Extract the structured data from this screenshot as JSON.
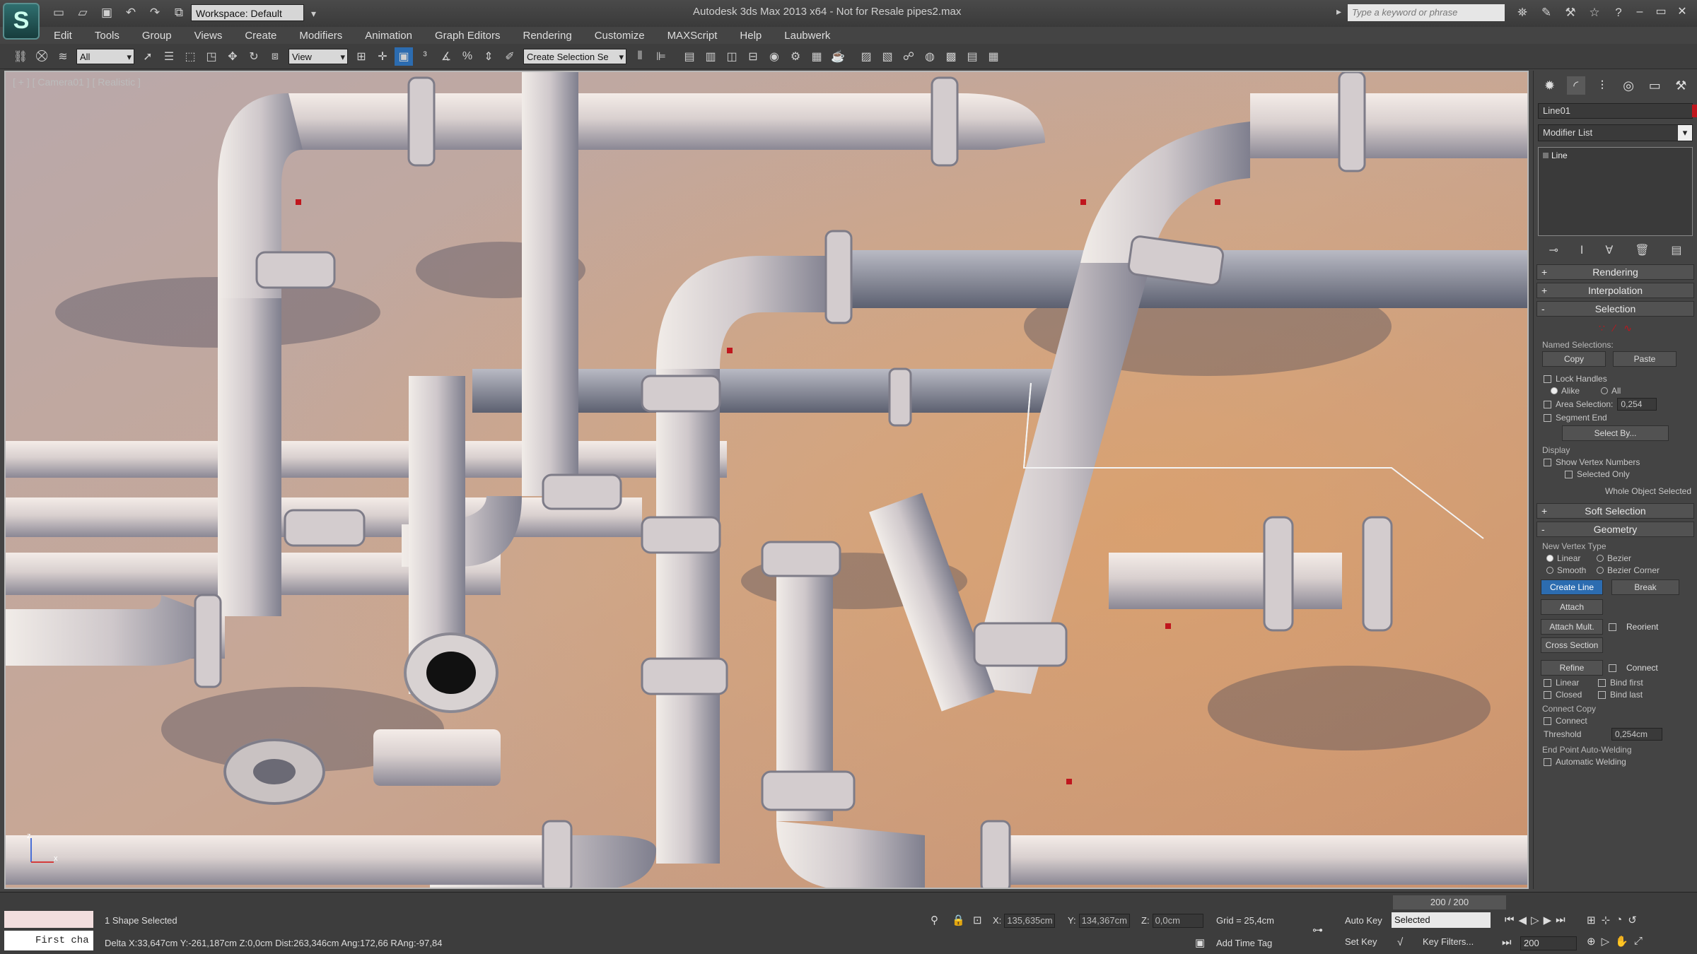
{
  "window": {
    "title": "Autodesk 3ds Max  2013 x64    - Not for Resale    pipes2.max",
    "workspace": "Workspace: Default",
    "search_placeholder": "Type a keyword or phrase"
  },
  "menu": [
    "Edit",
    "Tools",
    "Group",
    "Views",
    "Create",
    "Modifiers",
    "Animation",
    "Graph Editors",
    "Rendering",
    "Customize",
    "MAXScript",
    "Help",
    "Laubwerk"
  ],
  "toolbar": {
    "filter_select": "All",
    "view_select": "View",
    "selection_set": "Create Selection Se"
  },
  "viewport": {
    "label": "[ + ] [ Camera01 ] [ Realistic ]"
  },
  "command_panel": {
    "object_name": "Line01",
    "object_color": "#c0161d",
    "modifier_list": "Modifier List",
    "stack_item": "Line",
    "rollouts": {
      "rendering": "Rendering",
      "interpolation": "Interpolation",
      "selection": "Selection",
      "soft_selection": "Soft Selection",
      "geometry": "Geometry"
    },
    "selection": {
      "named_selections": "Named Selections:",
      "copy": "Copy",
      "paste": "Paste",
      "lock_handles": "Lock Handles",
      "alike": "Alike",
      "all": "All",
      "area_selection": "Area Selection:",
      "area_value": "0,254",
      "segment_end": "Segment End",
      "select_by": "Select By...",
      "display": "Display",
      "show_vertex_numbers": "Show Vertex Numbers",
      "selected_only": "Selected Only",
      "whole_object_selected": "Whole Object Selected"
    },
    "geometry": {
      "new_vertex_type": "New Vertex Type",
      "linear": "Linear",
      "bezier": "Bezier",
      "smooth": "Smooth",
      "bezier_corner": "Bezier Corner",
      "create_line": "Create Line",
      "break": "Break",
      "attach": "Attach",
      "reorient": "Reorient",
      "attach_mult": "Attach Mult.",
      "cross_section": "Cross Section",
      "refine": "Refine",
      "connect": "Connect",
      "linear2": "Linear",
      "bind_first": "Bind first",
      "closed": "Closed",
      "bind_last": "Bind last",
      "connect_copy": "Connect Copy",
      "connect2": "Connect",
      "threshold": "Threshold",
      "threshold_value": "0,254cm",
      "end_point_auto_welding": "End Point Auto-Welding",
      "automatic_welding": "Automatic Welding"
    }
  },
  "status": {
    "maxscript_input": "First cha",
    "prompt": "1 Shape Selected",
    "delta": "Delta X:33,647cm  Y:-261,187cm  Z:0,0cm  Dist:263,346cm  Ang:172,66 RAng:-97,84",
    "frame_counter": "200 / 200",
    "x_label": "X:",
    "x_value": "135,635cm",
    "y_label": "Y:",
    "y_value": "134,367cm",
    "z_label": "Z:",
    "z_value": "0,0cm",
    "grid": "Grid = 25,4cm",
    "add_time_tag": "Add Time Tag",
    "auto_key": "Auto Key",
    "set_key": "Set Key",
    "key_mode": "Selected",
    "key_filters": "Key Filters...",
    "frame": "200"
  }
}
